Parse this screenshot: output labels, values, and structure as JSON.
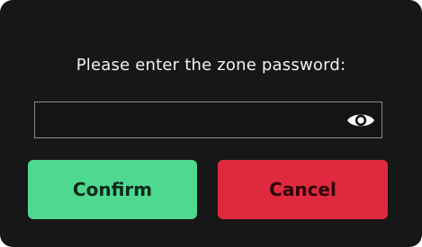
{
  "dialog": {
    "prompt": "Please enter the zone password:",
    "password_field": {
      "value": "",
      "placeholder": ""
    },
    "visibility_toggle_icon": "eye-icon",
    "confirm_label": "Confirm",
    "cancel_label": "Cancel"
  },
  "colors": {
    "background": "#171717",
    "confirm": "#4fd88f",
    "cancel": "#e0293f",
    "text": "#f2f2f2"
  }
}
